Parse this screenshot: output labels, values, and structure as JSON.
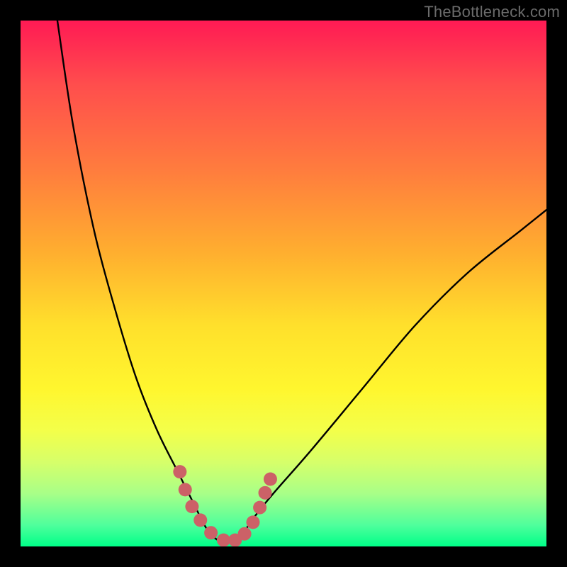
{
  "watermark": "TheBottleneck.com",
  "chart_data": {
    "type": "line",
    "title": "",
    "xlabel": "",
    "ylabel": "",
    "xlim": [
      0,
      100
    ],
    "ylim": [
      0,
      100
    ],
    "series": [
      {
        "name": "bottleneck-curve",
        "x": [
          7,
          10,
          14,
          18,
          22,
          26,
          30,
          33,
          35,
          36.5,
          38,
          40,
          42,
          44,
          48,
          55,
          65,
          75,
          85,
          95,
          100
        ],
        "y": [
          100,
          80,
          60,
          45,
          32,
          22,
          14,
          8,
          4,
          2,
          1,
          1,
          2,
          5,
          10,
          18,
          30,
          42,
          52,
          60,
          64
        ]
      }
    ],
    "markers": {
      "name": "highlight-dots",
      "color": "#cc6167",
      "x": [
        30.3,
        31.3,
        32.6,
        34.2,
        36.2,
        38.6,
        40.8,
        42.6,
        44.2,
        45.5,
        46.5,
        47.5
      ],
      "y": [
        14.2,
        10.8,
        7.6,
        5.0,
        2.6,
        1.2,
        1.2,
        2.4,
        4.6,
        7.4,
        10.2,
        12.8
      ]
    },
    "background_gradient": {
      "top": "#ff1a54",
      "bottom": "#00ff88"
    }
  }
}
